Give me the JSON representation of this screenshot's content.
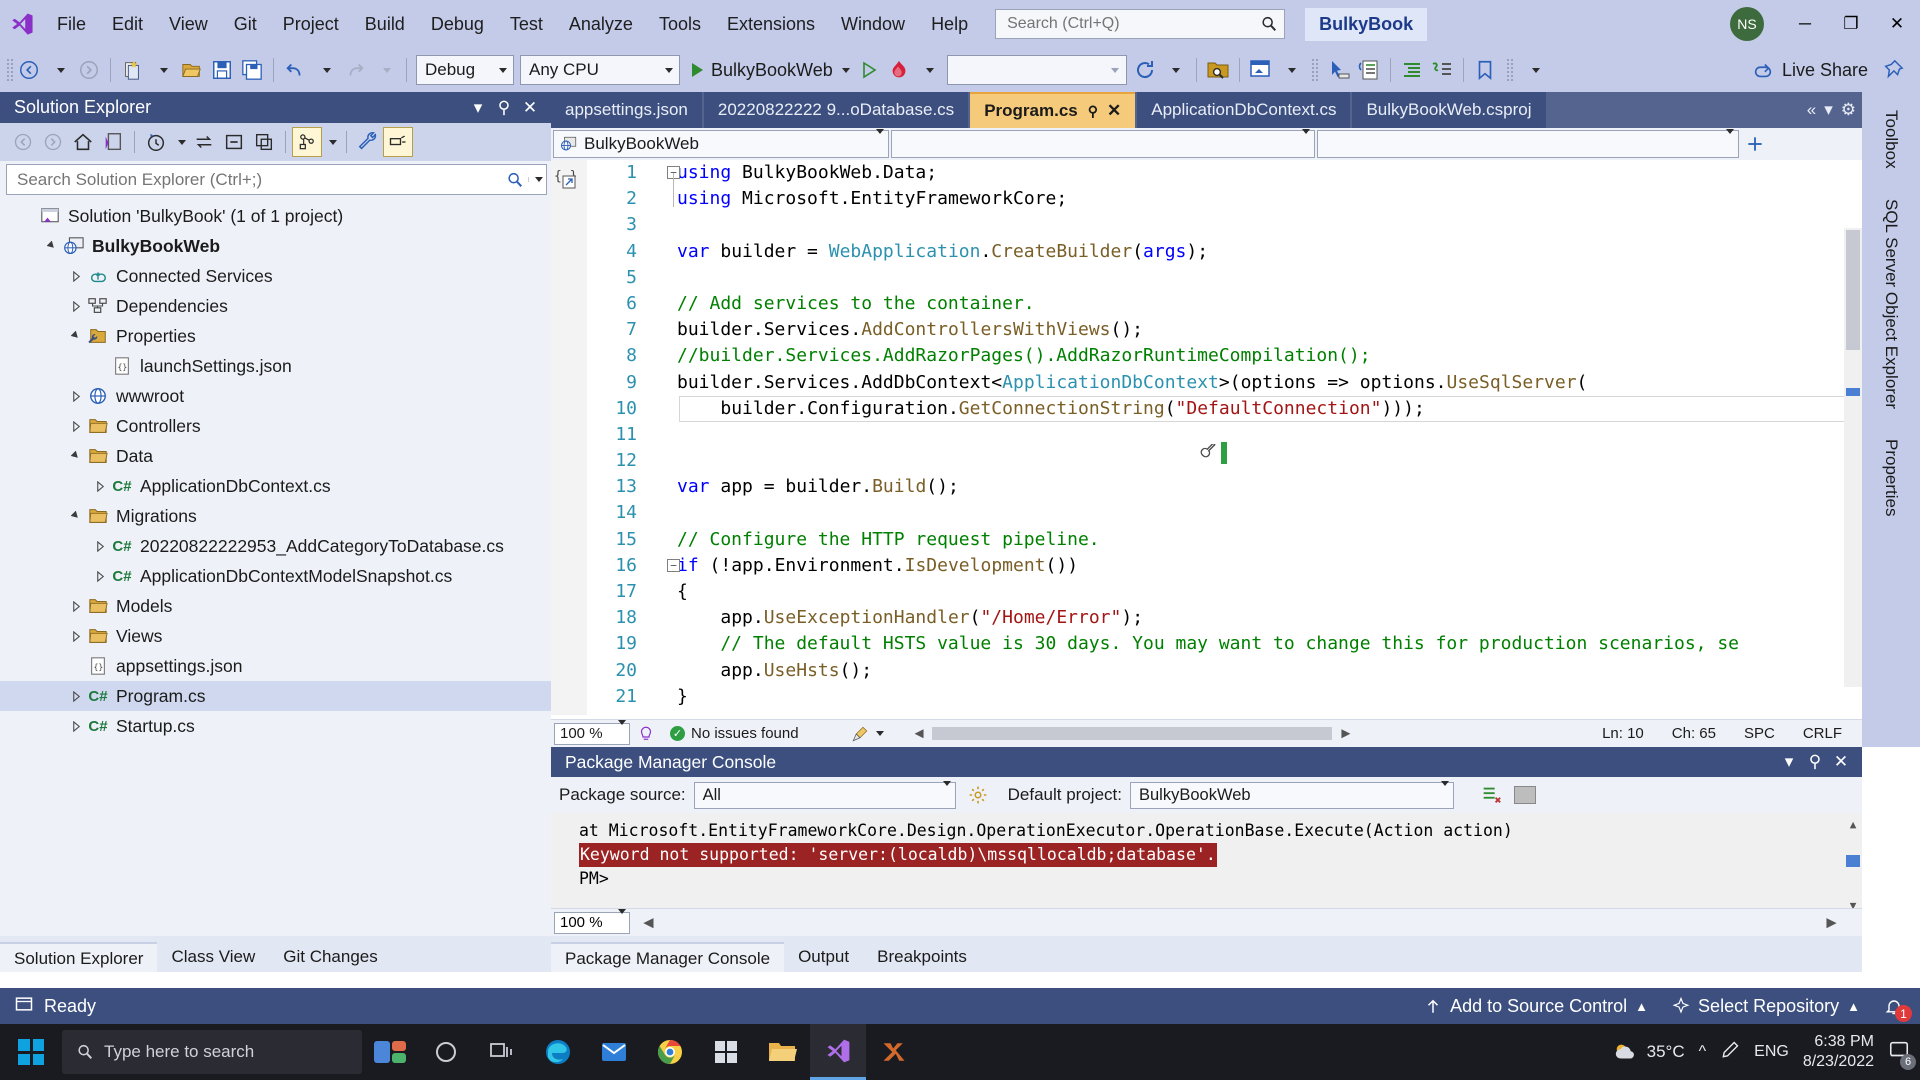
{
  "titlebar": {
    "menus": [
      "File",
      "Edit",
      "View",
      "Git",
      "Project",
      "Build",
      "Debug",
      "Test",
      "Analyze",
      "Tools",
      "Extensions",
      "Window",
      "Help"
    ],
    "search_placeholder": "Search (Ctrl+Q)",
    "account_name": "BulkyBook",
    "avatar_initials": "NS",
    "minimize": "─",
    "maximize": "❐",
    "close": "✕"
  },
  "toolbar": {
    "configuration": "Debug",
    "platform": "Any CPU",
    "start_target": "BulkyBookWeb",
    "blank_combo": "",
    "live_share": "Live Share"
  },
  "solution_explorer": {
    "title": "Solution Explorer",
    "search_placeholder": "Search Solution Explorer (Ctrl+;)",
    "tree": [
      {
        "label": "Solution 'BulkyBook' (1 of 1 project)",
        "indent": 0,
        "twist": "",
        "icon": "solution-icon",
        "bold": false,
        "selected": false
      },
      {
        "label": "BulkyBookWeb",
        "indent": 1,
        "twist": "expanded",
        "icon": "web-project-icon",
        "bold": true,
        "selected": false
      },
      {
        "label": "Connected Services",
        "indent": 2,
        "twist": "collapsed",
        "icon": "connected-services-icon",
        "bold": false,
        "selected": false
      },
      {
        "label": "Dependencies",
        "indent": 2,
        "twist": "collapsed",
        "icon": "dependencies-icon",
        "bold": false,
        "selected": false
      },
      {
        "label": "Properties",
        "indent": 2,
        "twist": "expanded",
        "icon": "properties-folder-icon",
        "bold": false,
        "selected": false
      },
      {
        "label": "launchSettings.json",
        "indent": 3,
        "twist": "",
        "icon": "json-file-icon",
        "bold": false,
        "selected": false
      },
      {
        "label": "wwwroot",
        "indent": 2,
        "twist": "collapsed",
        "icon": "wwwroot-icon",
        "bold": false,
        "selected": false
      },
      {
        "label": "Controllers",
        "indent": 2,
        "twist": "collapsed",
        "icon": "folder-icon",
        "bold": false,
        "selected": false
      },
      {
        "label": "Data",
        "indent": 2,
        "twist": "expanded",
        "icon": "folder-icon",
        "bold": false,
        "selected": false
      },
      {
        "label": "ApplicationDbContext.cs",
        "indent": 3,
        "twist": "collapsed",
        "icon": "csharp-file-icon",
        "bold": false,
        "selected": false
      },
      {
        "label": "Migrations",
        "indent": 2,
        "twist": "expanded",
        "icon": "folder-icon",
        "bold": false,
        "selected": false
      },
      {
        "label": "20220822222953_AddCategoryToDatabase.cs",
        "indent": 3,
        "twist": "collapsed",
        "icon": "csharp-file-icon",
        "bold": false,
        "selected": false
      },
      {
        "label": "ApplicationDbContextModelSnapshot.cs",
        "indent": 3,
        "twist": "collapsed",
        "icon": "csharp-file-icon",
        "bold": false,
        "selected": false
      },
      {
        "label": "Models",
        "indent": 2,
        "twist": "collapsed",
        "icon": "folder-icon",
        "bold": false,
        "selected": false
      },
      {
        "label": "Views",
        "indent": 2,
        "twist": "collapsed",
        "icon": "folder-icon",
        "bold": false,
        "selected": false
      },
      {
        "label": "appsettings.json",
        "indent": 2,
        "twist": "",
        "icon": "json-file-icon",
        "bold": false,
        "selected": false
      },
      {
        "label": "Program.cs",
        "indent": 2,
        "twist": "collapsed",
        "icon": "csharp-file-icon",
        "bold": false,
        "selected": true
      },
      {
        "label": "Startup.cs",
        "indent": 2,
        "twist": "collapsed",
        "icon": "csharp-file-icon",
        "bold": false,
        "selected": false
      }
    ],
    "bottom_tabs": [
      {
        "label": "Solution Explorer",
        "active": true
      },
      {
        "label": "Class View",
        "active": false
      },
      {
        "label": "Git Changes",
        "active": false
      }
    ]
  },
  "editor": {
    "tabs": [
      {
        "label": "appsettings.json",
        "active": false
      },
      {
        "label": "20220822222 9...oDatabase.cs",
        "active": false
      },
      {
        "label": "Program.cs",
        "active": true
      },
      {
        "label": "ApplicationDbContext.cs",
        "active": false
      },
      {
        "label": "BulkyBookWeb.csproj",
        "active": false
      }
    ],
    "nav_project": "BulkyBookWeb",
    "nav_type": "",
    "nav_member": "",
    "lines": [
      {
        "n": 1,
        "text": "using BulkyBookWeb.Data;"
      },
      {
        "n": 2,
        "text": "using Microsoft.EntityFrameworkCore;"
      },
      {
        "n": 3,
        "text": ""
      },
      {
        "n": 4,
        "text": "var builder = WebApplication.CreateBuilder(args);"
      },
      {
        "n": 5,
        "text": ""
      },
      {
        "n": 6,
        "text": "// Add services to the container."
      },
      {
        "n": 7,
        "text": "builder.Services.AddControllersWithViews();"
      },
      {
        "n": 8,
        "text": "//builder.Services.AddRazorPages().AddRazorRuntimeCompilation();"
      },
      {
        "n": 9,
        "text": "builder.Services.AddDbContext<ApplicationDbContext>(options => options.UseSqlServer("
      },
      {
        "n": 10,
        "text": "    builder.Configuration.GetConnectionString(\"DefaultConnection\")));"
      },
      {
        "n": 11,
        "text": ""
      },
      {
        "n": 12,
        "text": ""
      },
      {
        "n": 13,
        "text": "var app = builder.Build();"
      },
      {
        "n": 14,
        "text": ""
      },
      {
        "n": 15,
        "text": "// Configure the HTTP request pipeline."
      },
      {
        "n": 16,
        "text": "if (!app.Environment.IsDevelopment())"
      },
      {
        "n": 17,
        "text": "{"
      },
      {
        "n": 18,
        "text": "    app.UseExceptionHandler(\"/Home/Error\");"
      },
      {
        "n": 19,
        "text": "    // The default HSTS value is 30 days. You may want to change this for production scenarios, se"
      },
      {
        "n": 20,
        "text": "    app.UseHsts();"
      },
      {
        "n": 21,
        "text": "}"
      }
    ],
    "status": {
      "zoom": "100 %",
      "issues": "No issues found",
      "line": "Ln: 10",
      "col": "Ch: 65",
      "spaces": "SPC",
      "eol": "CRLF"
    }
  },
  "package_manager_console": {
    "title": "Package Manager Console",
    "source_label": "Package source:",
    "source_value": "All",
    "project_label": "Default project:",
    "project_value": "BulkyBookWeb",
    "output_lines": [
      {
        "text": "at Microsoft.EntityFrameworkCore.Design.OperationExecutor.OperationBase.Execute(Action action)",
        "error": false
      },
      {
        "text": "Keyword not supported: 'server:(localdb)\\mssqllocaldb;database'.",
        "error": true
      },
      {
        "text": "PM>",
        "error": false
      }
    ],
    "zoom": "100 %",
    "tabs": [
      {
        "label": "Package Manager Console",
        "active": true
      },
      {
        "label": "Output",
        "active": false
      },
      {
        "label": "Breakpoints",
        "active": false
      }
    ]
  },
  "right_rail": [
    "Toolbox",
    "SQL Server Object Explorer",
    "Properties"
  ],
  "statusbar": {
    "ready": "Ready",
    "add_to_source_control": "Add to Source Control",
    "select_repository": "Select Repository",
    "notification_count": "1"
  },
  "taskbar": {
    "search_placeholder": "Type here to search",
    "weather_temp": "35°C",
    "language": "ENG",
    "time": "6:38 PM",
    "date": "8/23/2022",
    "tray_count": "6"
  }
}
